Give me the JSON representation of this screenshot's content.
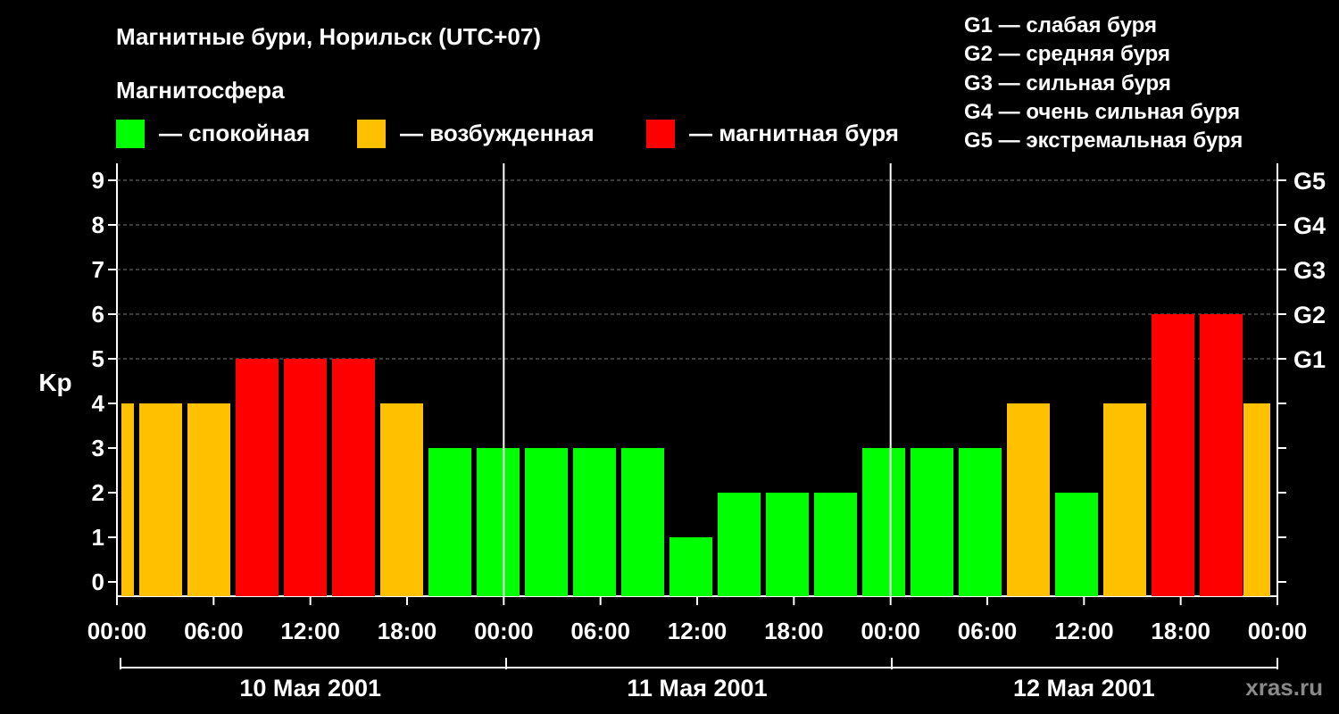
{
  "title": "Магнитные бури, Норильск (UTC+07)",
  "legend": {
    "heading": "Магнитосфера",
    "items": [
      {
        "color": "#00ff00",
        "label": "— спокойная"
      },
      {
        "color": "#ffc000",
        "label": "— возбужденная"
      },
      {
        "color": "#ff0000",
        "label": "— магнитная буря"
      }
    ]
  },
  "g_scale": [
    "G1 — слабая буря",
    "G2 — средняя буря",
    "G3 — сильная буря",
    "G4 — очень сильная буря",
    "G5 — экстремальная буря"
  ],
  "watermark": "xras.ru",
  "colors": {
    "quiet": "#00ff00",
    "active": "#ffc000",
    "storm": "#ff0000",
    "background": "#000000"
  },
  "chart_data": {
    "type": "bar",
    "ylabel": "Kp",
    "ylim": [
      0,
      9
    ],
    "y_ticks": [
      "0",
      "1",
      "2",
      "3",
      "4",
      "5",
      "6",
      "7",
      "8",
      "9"
    ],
    "right_ticks": [
      {
        "kp": 5,
        "label": "G1"
      },
      {
        "kp": 6,
        "label": "G2"
      },
      {
        "kp": 7,
        "label": "G3"
      },
      {
        "kp": 8,
        "label": "G4"
      },
      {
        "kp": 9,
        "label": "G5"
      }
    ],
    "x_tick_labels": [
      "00:00",
      "06:00",
      "12:00",
      "18:00",
      "00:00",
      "06:00",
      "12:00",
      "18:00",
      "00:00",
      "06:00",
      "12:00",
      "18:00",
      "00:00"
    ],
    "days": [
      "10 Мая 2001",
      "11 Мая 2001",
      "12 Мая 2001"
    ],
    "interval_hours": 3,
    "grid": true,
    "values": [
      4,
      4,
      4,
      5,
      5,
      5,
      4,
      3,
      3,
      3,
      3,
      3,
      1,
      2,
      2,
      2,
      3,
      3,
      3,
      4,
      2,
      4,
      6,
      6,
      4
    ],
    "levels": [
      "active",
      "active",
      "active",
      "storm",
      "storm",
      "storm",
      "active",
      "quiet",
      "quiet",
      "quiet",
      "quiet",
      "quiet",
      "quiet",
      "quiet",
      "quiet",
      "quiet",
      "quiet",
      "quiet",
      "quiet",
      "active",
      "quiet",
      "active",
      "storm",
      "storm",
      "active"
    ]
  }
}
